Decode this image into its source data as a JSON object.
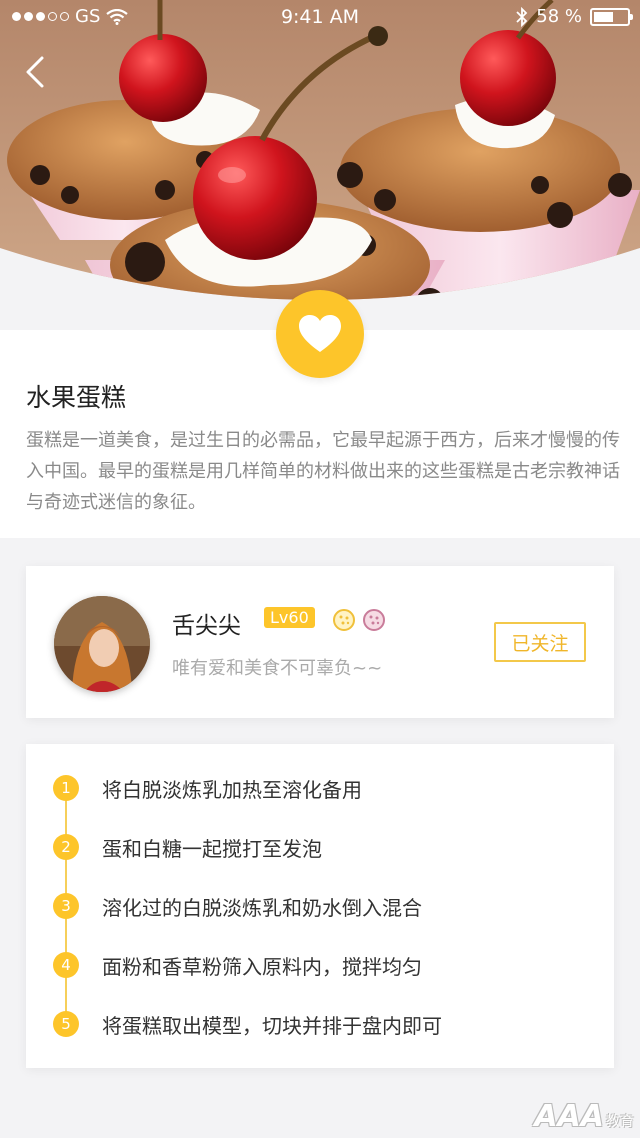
{
  "status_bar": {
    "carrier": "GS",
    "time": "9:41 AM",
    "battery": "58 %",
    "battery_level": 0.58
  },
  "recipe": {
    "title": "水果蛋糕",
    "description": "蛋糕是一道美食，是过生日的必需品，它最早起源于西方，后来才慢慢的传入中国。最早的蛋糕是用几样简单的材料做出来的这些蛋糕是古老宗教神话与奇迹式迷信的象征。"
  },
  "author": {
    "name": "舌尖尖",
    "level": "Lv60",
    "motto": "唯有爱和美食不可辜负~~",
    "follow_label": "已关注"
  },
  "steps": [
    {
      "num": "1",
      "text": "将白脱淡炼乳加热至溶化备用"
    },
    {
      "num": "2",
      "text": "蛋和白糖一起搅打至发泡"
    },
    {
      "num": "3",
      "text": "溶化过的白脱淡炼乳和奶水倒入混合"
    },
    {
      "num": "4",
      "text": "面粉和香草粉筛入原料内，搅拌均匀"
    },
    {
      "num": "5",
      "text": "将蛋糕取出模型，切块并排于盘内即可"
    }
  ],
  "watermark": {
    "main": "AAA",
    "sub": "教育"
  },
  "colors": {
    "accent": "#fdc52a",
    "follow": "#f0b62a"
  },
  "icons": {
    "back": "chevron-left-icon",
    "favorite": "heart-icon",
    "wifi": "wifi-icon",
    "bluetooth": "bluetooth-icon"
  }
}
